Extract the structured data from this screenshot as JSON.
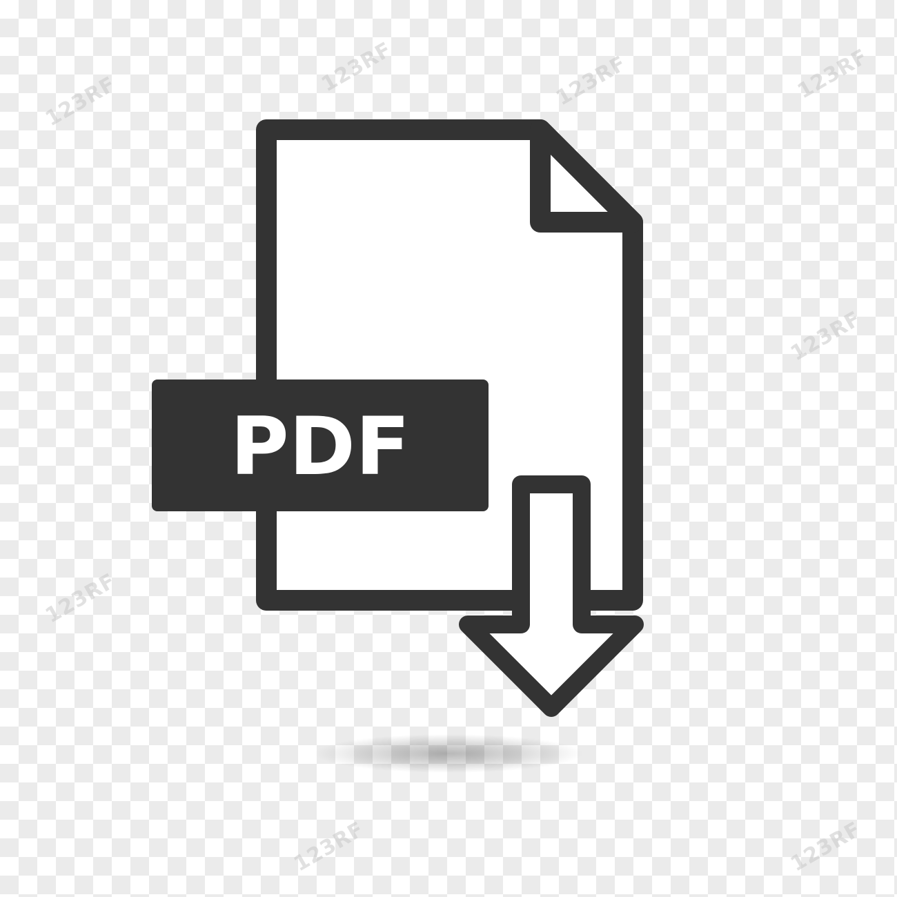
{
  "icon": {
    "name": "pdf-download-icon",
    "badge_text": "PDF",
    "colors": {
      "stroke": "#333333",
      "fill": "#ffffff",
      "badge": "#333333",
      "badge_text": "#ffffff",
      "background_light": "#ffffff",
      "background_dark": "#ebebeb"
    }
  },
  "watermark": {
    "text": "123RF"
  }
}
